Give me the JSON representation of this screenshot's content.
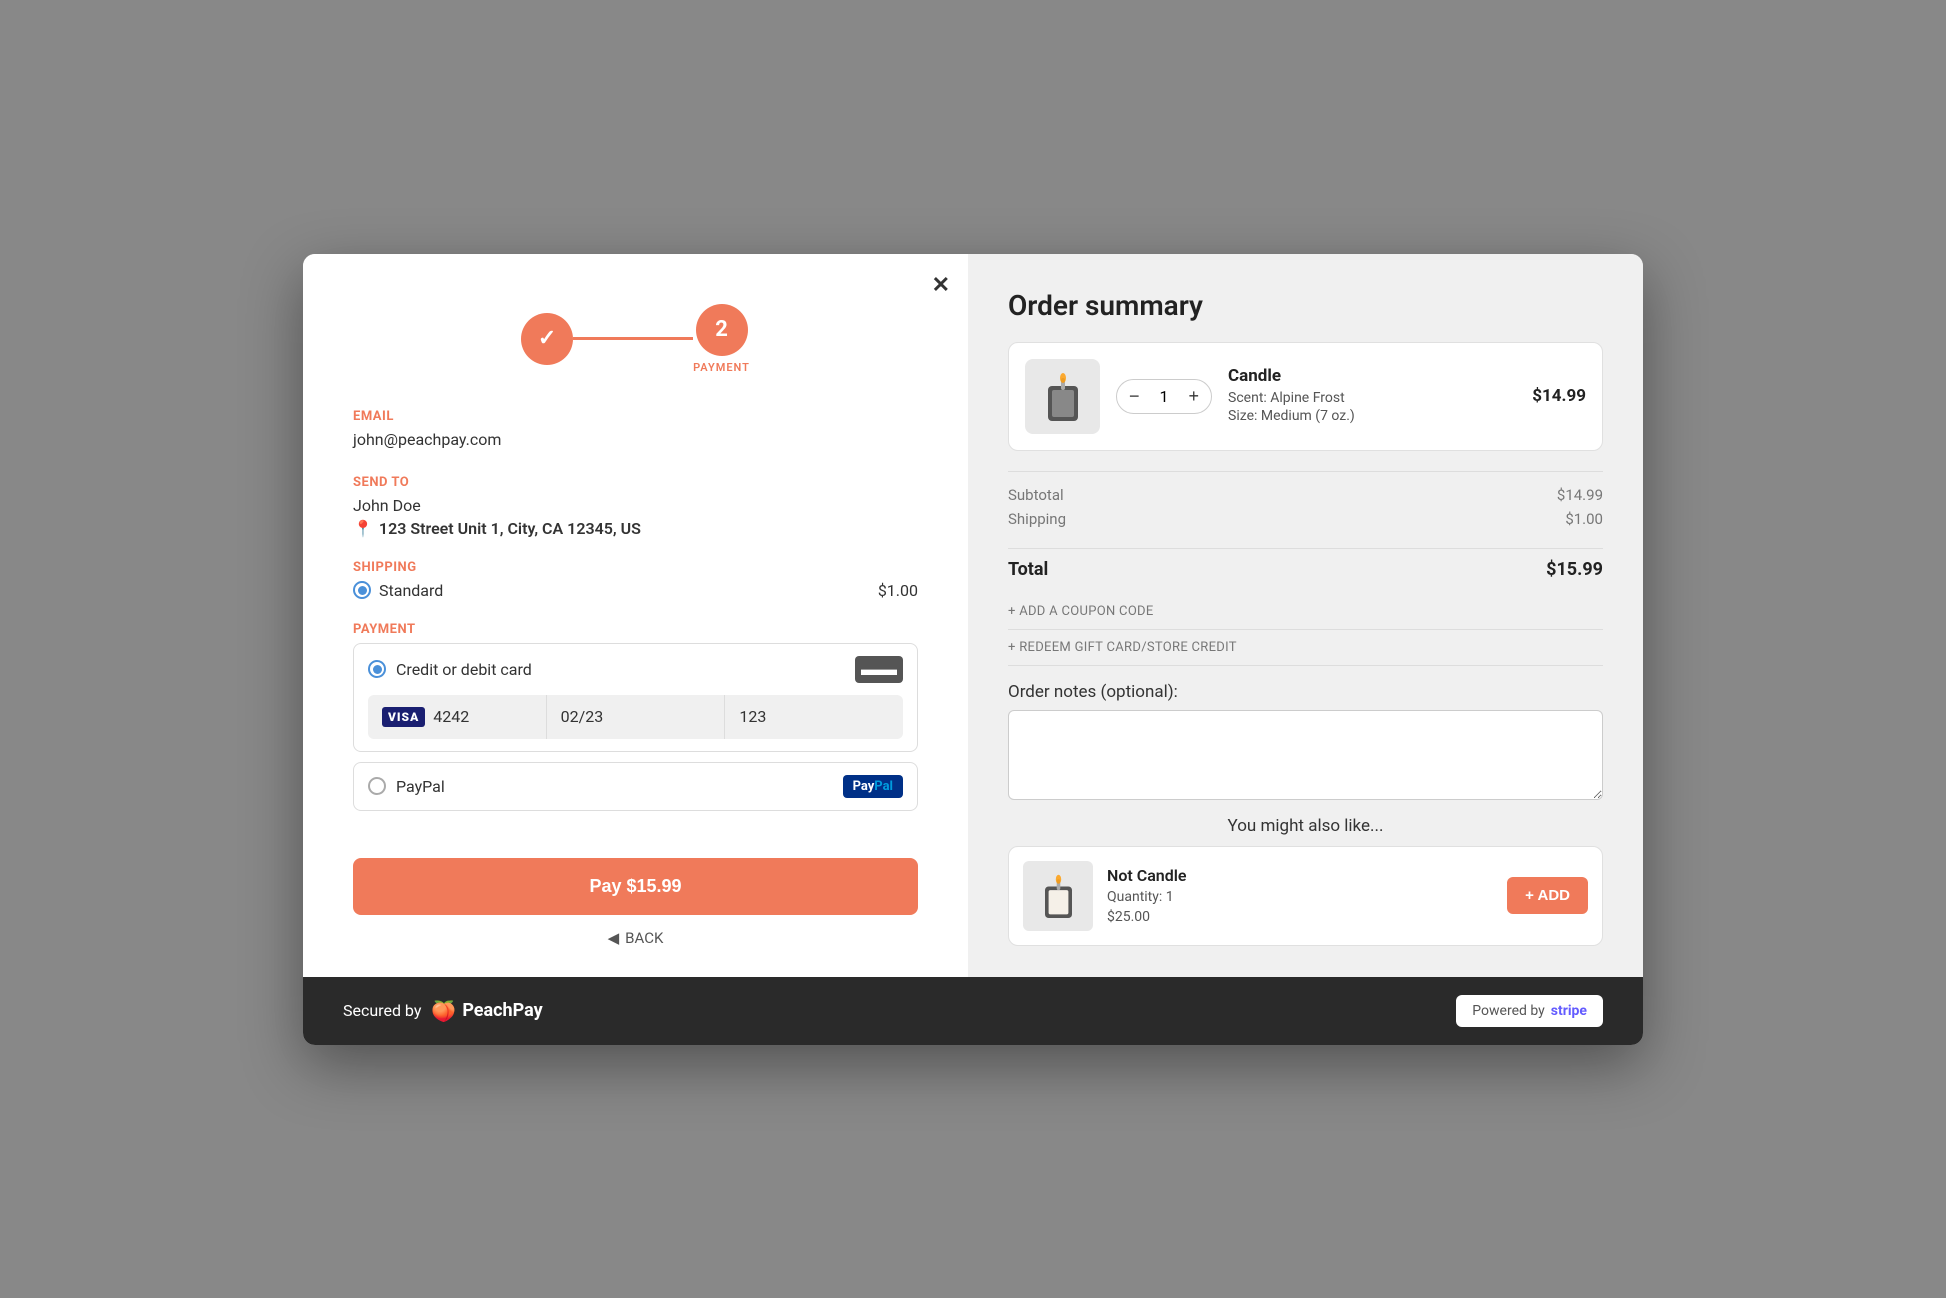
{
  "modal": {
    "close_label": "✕"
  },
  "stepper": {
    "step1_check": "✓",
    "step2_number": "2",
    "step2_label": "PAYMENT"
  },
  "left": {
    "email_label": "EMAIL",
    "email_value": "john@peachpay.com",
    "sendto_label": "SEND TO",
    "sendto_name": "John Doe",
    "sendto_address": "123 Street Unit 1, City, CA 12345, US",
    "shipping_label": "SHIPPING",
    "shipping_option": "Standard",
    "shipping_price": "$1.00",
    "payment_label": "PAYMENT",
    "payment_card_label": "Credit or debit card",
    "card_number": "4242",
    "card_expiry": "02/23",
    "card_cvc": "123",
    "paypal_label": "PayPal",
    "pay_button": "Pay $15.99",
    "back_label": "BACK"
  },
  "right": {
    "title": "Order summary",
    "product": {
      "name": "Candle",
      "scent": "Scent: Alpine Frost",
      "size": "Size: Medium (7 oz.)",
      "qty": "1",
      "price": "$14.99"
    },
    "subtotal_label": "Subtotal",
    "subtotal_value": "$14.99",
    "shipping_label": "Shipping",
    "shipping_value": "$1.00",
    "total_label": "Total",
    "total_value": "$15.99",
    "coupon_label": "+ ADD A COUPON CODE",
    "giftcard_label": "+ REDEEM GIFT CARD/STORE CREDIT",
    "notes_label": "Order notes (optional):",
    "upsell_title": "You might also like...",
    "upsell": {
      "name": "Not Candle",
      "qty": "Quantity: 1",
      "price": "$25.00",
      "add_btn": "+ ADD"
    }
  },
  "footer": {
    "secured_text": "Secured by",
    "brand_name": "PeachPay",
    "stripe_text": "Powered by",
    "stripe_brand": "stripe"
  }
}
